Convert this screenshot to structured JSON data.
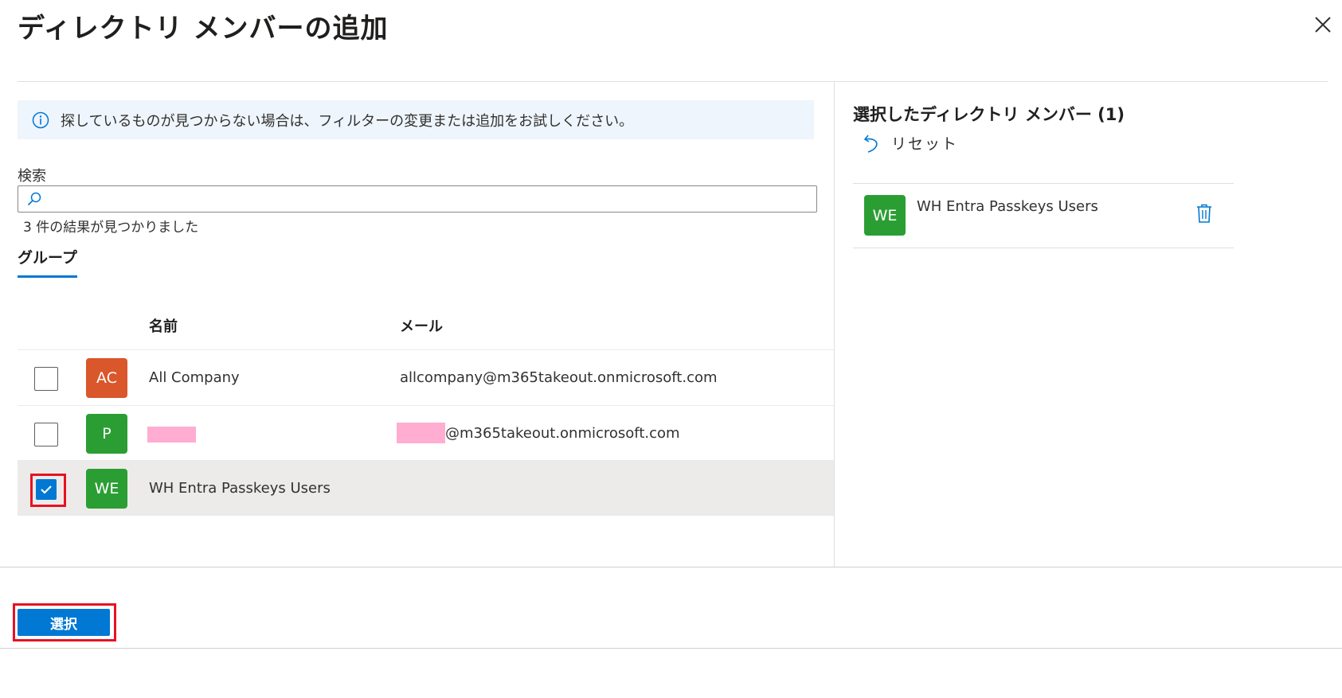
{
  "dialog": {
    "title": "ディレクトリ メンバーの追加",
    "close_icon": "close-icon"
  },
  "info": {
    "icon": "info-icon",
    "text": "探しているものが見つからない場合は、フィルターの変更または追加をお試しください。"
  },
  "search": {
    "label": "検索",
    "value": "",
    "placeholder": "",
    "results_text": "3 件の結果が見つかりました"
  },
  "tabs": [
    {
      "label": "グループ",
      "active": true
    }
  ],
  "table": {
    "columns": [
      "名前",
      "メール"
    ],
    "rows": [
      {
        "initials": "AC",
        "avatar_color": "#d9572b",
        "name": "All Company",
        "email": "allcompany@m365takeout.onmicrosoft.com",
        "checked": false
      },
      {
        "initials": "P",
        "avatar_color": "#2b9e33",
        "name": "",
        "email": "@m365takeout.onmicrosoft.com",
        "checked": false,
        "redacted": true
      },
      {
        "initials": "WE",
        "avatar_color": "#2b9e33",
        "name": "WH Entra Passkeys Users",
        "email": "",
        "checked": true
      }
    ]
  },
  "selected_panel": {
    "title": "選択したディレクトリ メンバー (1)",
    "reset_label": "リセット",
    "items": [
      {
        "initials": "WE",
        "avatar_color": "#2b9e33",
        "name": "WH Entra Passkeys Users"
      }
    ]
  },
  "footer": {
    "select_label": "選択"
  },
  "colors": {
    "accent": "#0078d4",
    "highlight": "#e81123",
    "redaction": "#ffadd0",
    "info_bg": "#eef5fc"
  }
}
